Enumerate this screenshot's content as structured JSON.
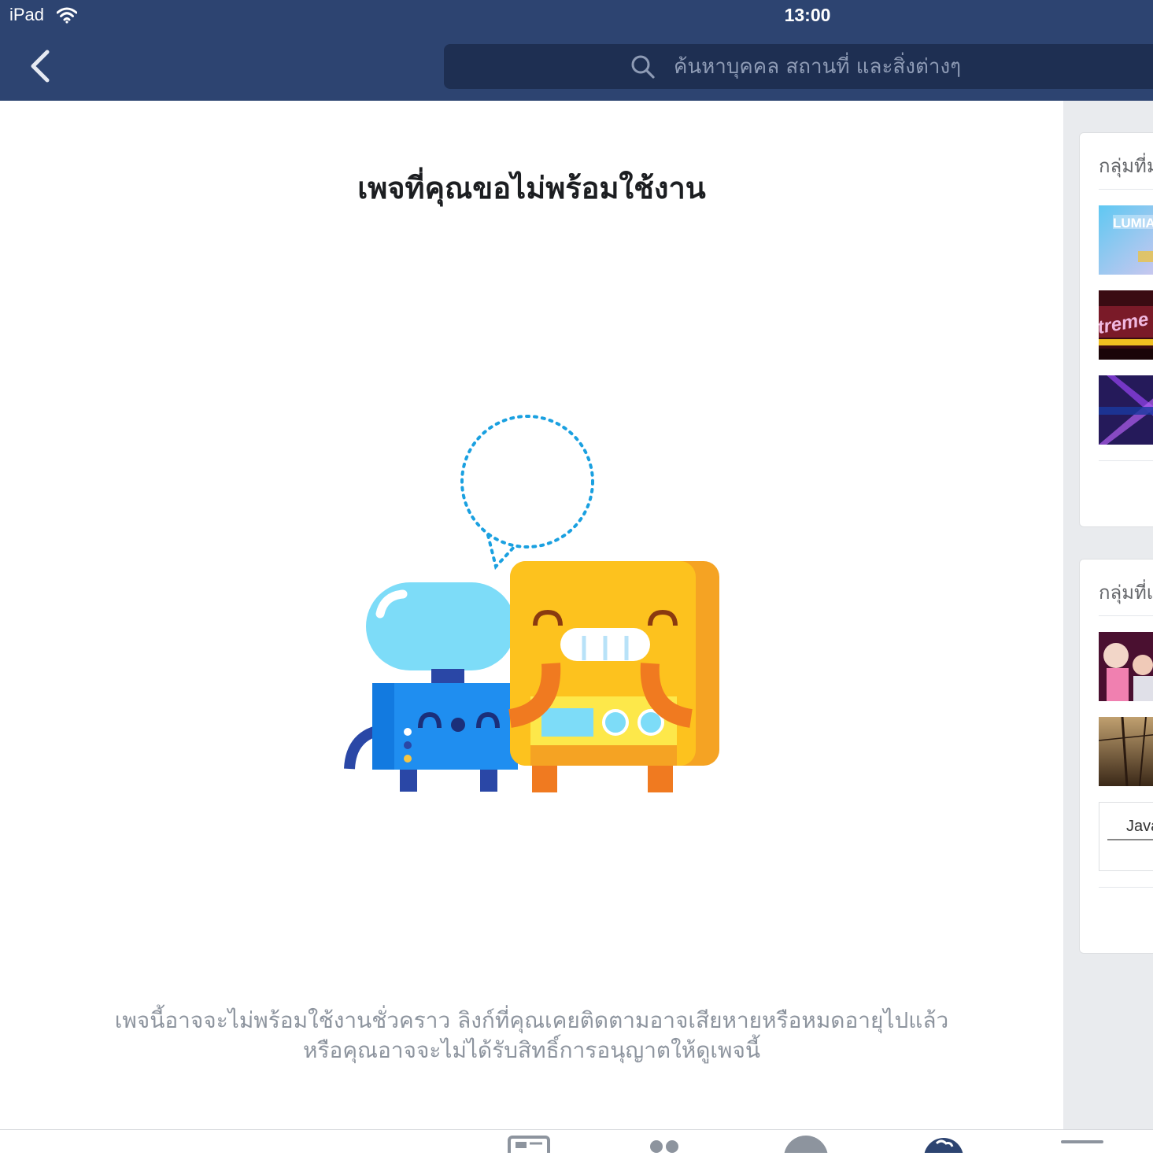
{
  "status_bar": {
    "device": "iPad",
    "time": "13:00"
  },
  "nav": {
    "search_placeholder": "ค้นหาบุคคล สถานที่ และสิ่งต่างๆ"
  },
  "main": {
    "title": "เพจที่คุณขอไม่พร้อมใช้งาน",
    "message_line1": "เพจนี้อาจจะไม่พร้อมใช้งานชั่วคราว ลิงก์ที่คุณเคยติดตามอาจเสียหายหรือหมดอายุไปแล้ว",
    "message_line2": "หรือคุณอาจจะไม่ได้รับสิทธิ์การอนุญาตให้ดูเพจนี้"
  },
  "sidebar": {
    "cards": [
      {
        "title": "กลุ่มที่ม",
        "thumb_labels": [
          "LUMIA",
          "treme",
          ""
        ]
      },
      {
        "title": "กลุ่มที่เ",
        "thumb_labels": [
          "",
          "",
          "Java"
        ]
      }
    ]
  },
  "tabbar": {
    "icons": [
      "news-feed-icon",
      "friends-icon",
      "profile-icon",
      "globe-icon",
      "menu-icon"
    ]
  }
}
